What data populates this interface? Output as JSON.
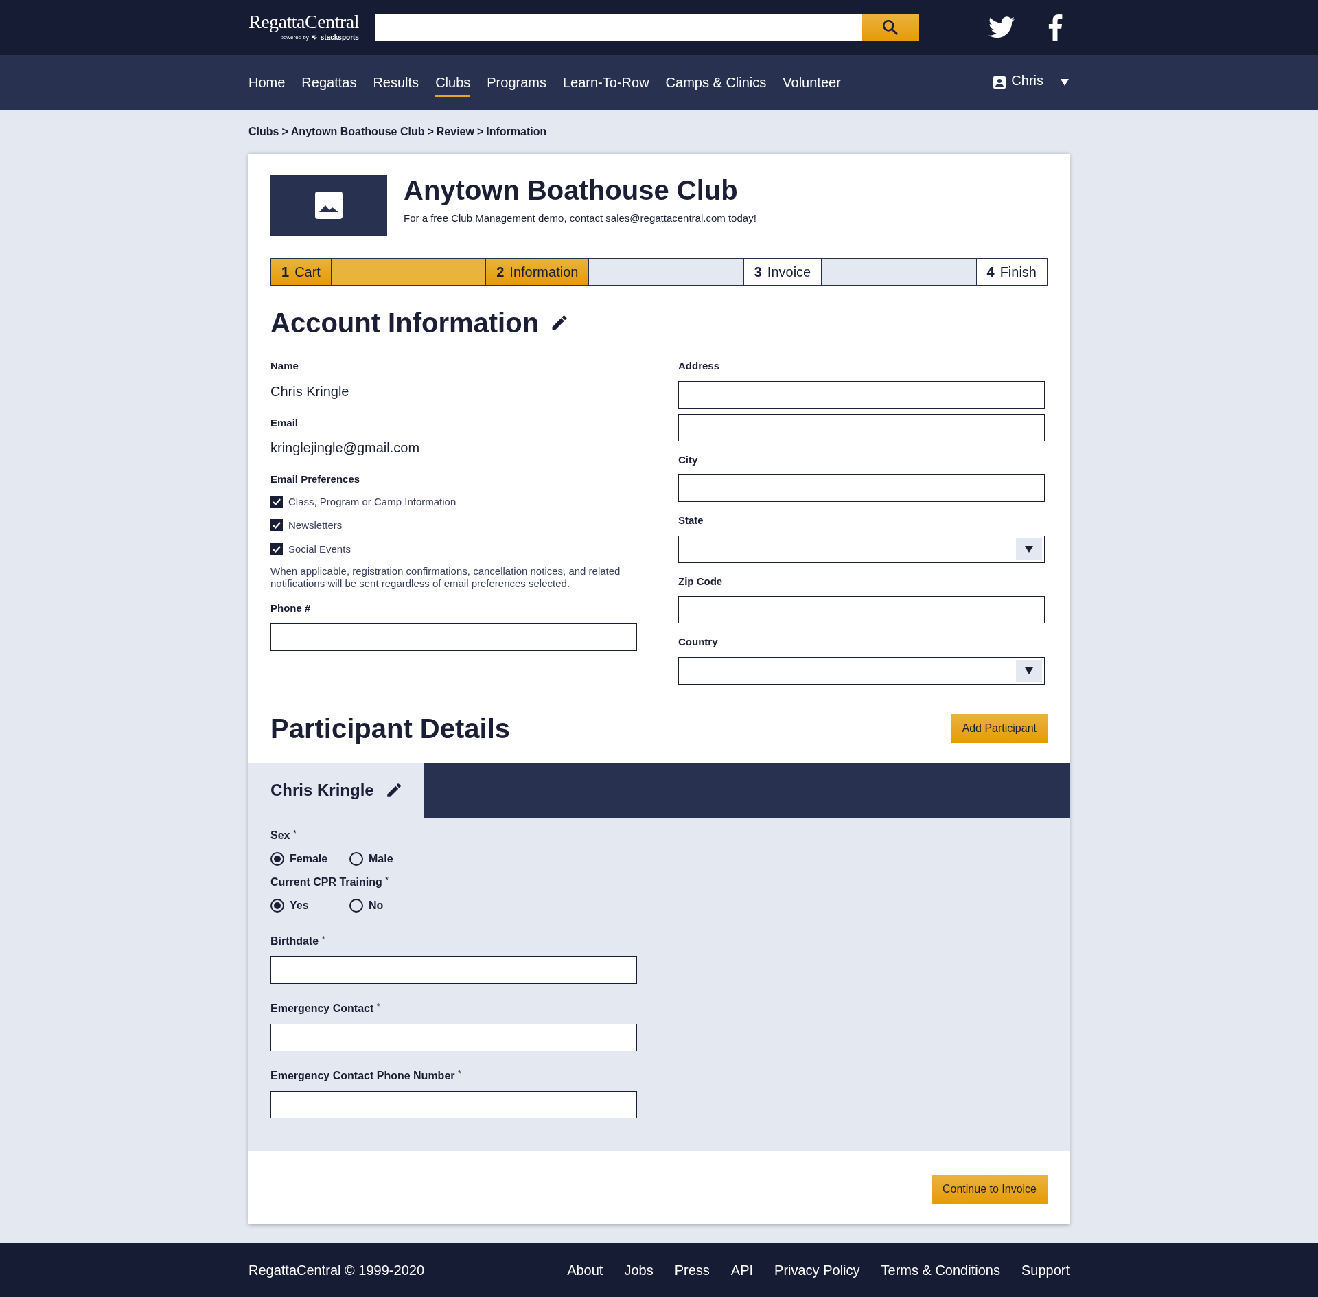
{
  "header": {
    "logo": {
      "name": "RegattaCentral",
      "tagline": "powered by",
      "partner": "stacksports"
    }
  },
  "nav": {
    "items": [
      {
        "label": "Home",
        "selected": false
      },
      {
        "label": "Regattas",
        "selected": false
      },
      {
        "label": "Results",
        "selected": false
      },
      {
        "label": "Clubs",
        "selected": true
      },
      {
        "label": "Programs",
        "selected": false
      },
      {
        "label": "Learn-To-Row",
        "selected": false
      },
      {
        "label": "Camps & Clinics",
        "selected": false
      },
      {
        "label": "Volunteer",
        "selected": false
      }
    ],
    "user": "Chris"
  },
  "breadcrumb": {
    "separator": ">",
    "items": [
      "Clubs",
      "Anytown Boathouse Club",
      "Review",
      "Information"
    ]
  },
  "club": {
    "name": "Anytown Boathouse Club",
    "note": "For a free Club Management demo, contact sales@regattacentral.com today!"
  },
  "steps": [
    {
      "number": "1",
      "label": "Cart",
      "done": true
    },
    {
      "number": "2",
      "label": "Information",
      "done": true
    },
    {
      "number": "3",
      "label": "Invoice",
      "done": false
    },
    {
      "number": "4",
      "label": "Finish",
      "done": false
    }
  ],
  "account": {
    "title": "Account Information",
    "left": [
      {
        "kind": "value",
        "label": "Name",
        "value": "Chris Kringle"
      },
      {
        "kind": "value",
        "label": "Email",
        "value": "kringlejingle@gmail.com"
      },
      {
        "kind": "checks",
        "label": "Email Preferences",
        "options": [
          {
            "label": "Class, Program or Camp Information",
            "checked": true
          },
          {
            "label": "Newsletters",
            "checked": true
          },
          {
            "label": "Social Events",
            "checked": true
          }
        ],
        "note": "When applicable, registration confirmations, cancellation notices, and related notifications will be sent regardless of email preferences selected."
      },
      {
        "kind": "input",
        "label": "Phone #"
      }
    ],
    "right": [
      {
        "kind": "double",
        "label": "Address"
      },
      {
        "kind": "input",
        "label": "City"
      },
      {
        "kind": "select",
        "label": "State"
      },
      {
        "kind": "input",
        "label": "Zip Code"
      },
      {
        "kind": "select",
        "label": "Country"
      }
    ]
  },
  "participants": {
    "title": "Participant Details",
    "add_button": "Add Participant",
    "tabs": [
      {
        "name": "Chris Kringle",
        "selected": true
      }
    ],
    "fields": [
      {
        "kind": "radio",
        "label": "Sex",
        "mark": "*",
        "options": [
          {
            "label": "Female",
            "selected": true
          },
          {
            "label": "Male",
            "selected": false
          }
        ]
      },
      {
        "kind": "radio",
        "label": "Current CPR Training",
        "mark": "*",
        "options": [
          {
            "label": "Yes",
            "selected": true
          },
          {
            "label": "No",
            "selected": false
          }
        ]
      },
      {
        "kind": "input",
        "label": "Birthdate",
        "mark": "*"
      },
      {
        "kind": "input",
        "label": "Emergency Contact",
        "mark": "*"
      },
      {
        "kind": "input",
        "label": "Emergency Contact Phone Number",
        "mark": "*"
      }
    ]
  },
  "continue_button": "Continue to Invoice",
  "footer": {
    "copyright": "RegattaCentral © 1999-2020",
    "links": [
      "About",
      "Jobs",
      "Press",
      "API",
      "Privacy Policy",
      "Terms & Conditions",
      "Support"
    ]
  }
}
